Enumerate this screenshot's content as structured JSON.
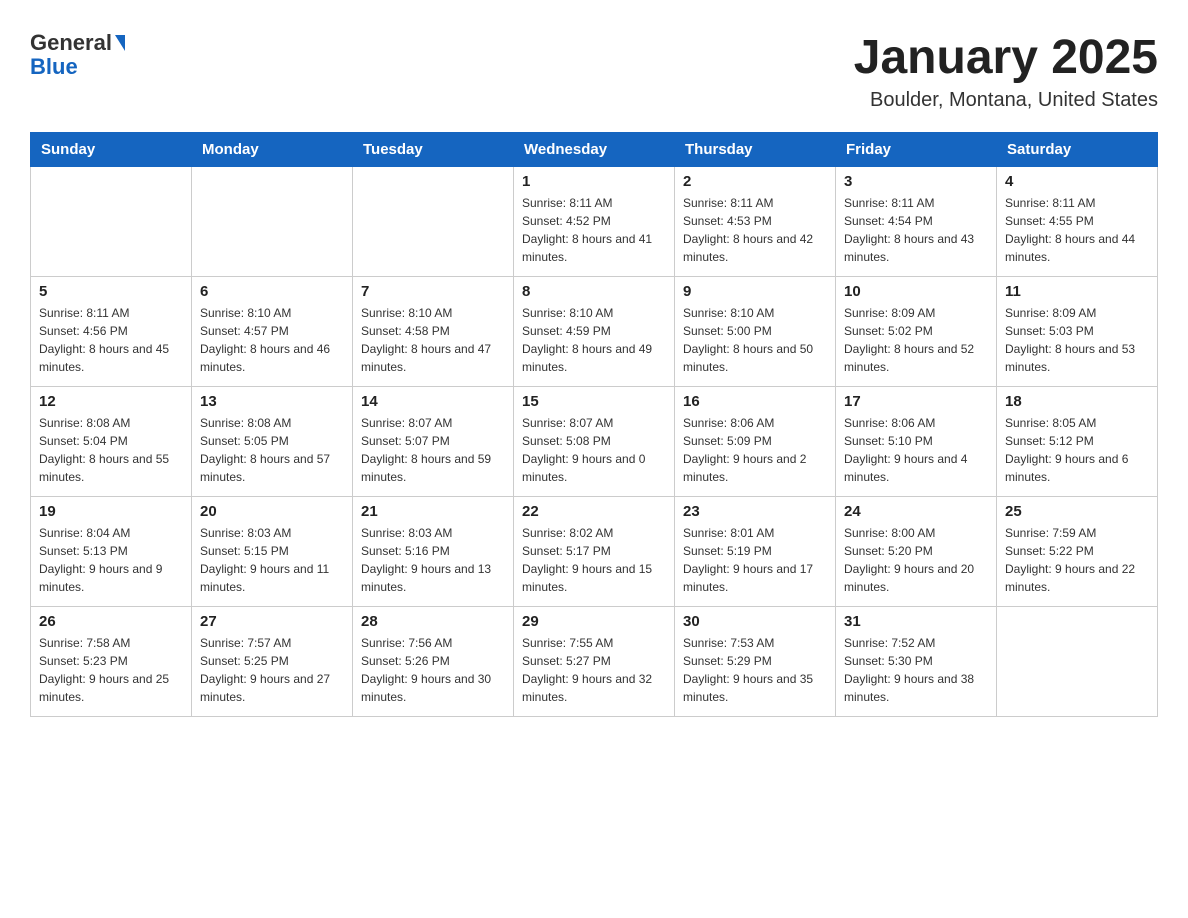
{
  "header": {
    "logo_line1": "General",
    "logo_line2": "Blue",
    "month_title": "January 2025",
    "location": "Boulder, Montana, United States"
  },
  "days_of_week": [
    "Sunday",
    "Monday",
    "Tuesday",
    "Wednesday",
    "Thursday",
    "Friday",
    "Saturday"
  ],
  "weeks": [
    [
      {
        "day": "",
        "sunrise": "",
        "sunset": "",
        "daylight": ""
      },
      {
        "day": "",
        "sunrise": "",
        "sunset": "",
        "daylight": ""
      },
      {
        "day": "",
        "sunrise": "",
        "sunset": "",
        "daylight": ""
      },
      {
        "day": "1",
        "sunrise": "Sunrise: 8:11 AM",
        "sunset": "Sunset: 4:52 PM",
        "daylight": "Daylight: 8 hours and 41 minutes."
      },
      {
        "day": "2",
        "sunrise": "Sunrise: 8:11 AM",
        "sunset": "Sunset: 4:53 PM",
        "daylight": "Daylight: 8 hours and 42 minutes."
      },
      {
        "day": "3",
        "sunrise": "Sunrise: 8:11 AM",
        "sunset": "Sunset: 4:54 PM",
        "daylight": "Daylight: 8 hours and 43 minutes."
      },
      {
        "day": "4",
        "sunrise": "Sunrise: 8:11 AM",
        "sunset": "Sunset: 4:55 PM",
        "daylight": "Daylight: 8 hours and 44 minutes."
      }
    ],
    [
      {
        "day": "5",
        "sunrise": "Sunrise: 8:11 AM",
        "sunset": "Sunset: 4:56 PM",
        "daylight": "Daylight: 8 hours and 45 minutes."
      },
      {
        "day": "6",
        "sunrise": "Sunrise: 8:10 AM",
        "sunset": "Sunset: 4:57 PM",
        "daylight": "Daylight: 8 hours and 46 minutes."
      },
      {
        "day": "7",
        "sunrise": "Sunrise: 8:10 AM",
        "sunset": "Sunset: 4:58 PM",
        "daylight": "Daylight: 8 hours and 47 minutes."
      },
      {
        "day": "8",
        "sunrise": "Sunrise: 8:10 AM",
        "sunset": "Sunset: 4:59 PM",
        "daylight": "Daylight: 8 hours and 49 minutes."
      },
      {
        "day": "9",
        "sunrise": "Sunrise: 8:10 AM",
        "sunset": "Sunset: 5:00 PM",
        "daylight": "Daylight: 8 hours and 50 minutes."
      },
      {
        "day": "10",
        "sunrise": "Sunrise: 8:09 AM",
        "sunset": "Sunset: 5:02 PM",
        "daylight": "Daylight: 8 hours and 52 minutes."
      },
      {
        "day": "11",
        "sunrise": "Sunrise: 8:09 AM",
        "sunset": "Sunset: 5:03 PM",
        "daylight": "Daylight: 8 hours and 53 minutes."
      }
    ],
    [
      {
        "day": "12",
        "sunrise": "Sunrise: 8:08 AM",
        "sunset": "Sunset: 5:04 PM",
        "daylight": "Daylight: 8 hours and 55 minutes."
      },
      {
        "day": "13",
        "sunrise": "Sunrise: 8:08 AM",
        "sunset": "Sunset: 5:05 PM",
        "daylight": "Daylight: 8 hours and 57 minutes."
      },
      {
        "day": "14",
        "sunrise": "Sunrise: 8:07 AM",
        "sunset": "Sunset: 5:07 PM",
        "daylight": "Daylight: 8 hours and 59 minutes."
      },
      {
        "day": "15",
        "sunrise": "Sunrise: 8:07 AM",
        "sunset": "Sunset: 5:08 PM",
        "daylight": "Daylight: 9 hours and 0 minutes."
      },
      {
        "day": "16",
        "sunrise": "Sunrise: 8:06 AM",
        "sunset": "Sunset: 5:09 PM",
        "daylight": "Daylight: 9 hours and 2 minutes."
      },
      {
        "day": "17",
        "sunrise": "Sunrise: 8:06 AM",
        "sunset": "Sunset: 5:10 PM",
        "daylight": "Daylight: 9 hours and 4 minutes."
      },
      {
        "day": "18",
        "sunrise": "Sunrise: 8:05 AM",
        "sunset": "Sunset: 5:12 PM",
        "daylight": "Daylight: 9 hours and 6 minutes."
      }
    ],
    [
      {
        "day": "19",
        "sunrise": "Sunrise: 8:04 AM",
        "sunset": "Sunset: 5:13 PM",
        "daylight": "Daylight: 9 hours and 9 minutes."
      },
      {
        "day": "20",
        "sunrise": "Sunrise: 8:03 AM",
        "sunset": "Sunset: 5:15 PM",
        "daylight": "Daylight: 9 hours and 11 minutes."
      },
      {
        "day": "21",
        "sunrise": "Sunrise: 8:03 AM",
        "sunset": "Sunset: 5:16 PM",
        "daylight": "Daylight: 9 hours and 13 minutes."
      },
      {
        "day": "22",
        "sunrise": "Sunrise: 8:02 AM",
        "sunset": "Sunset: 5:17 PM",
        "daylight": "Daylight: 9 hours and 15 minutes."
      },
      {
        "day": "23",
        "sunrise": "Sunrise: 8:01 AM",
        "sunset": "Sunset: 5:19 PM",
        "daylight": "Daylight: 9 hours and 17 minutes."
      },
      {
        "day": "24",
        "sunrise": "Sunrise: 8:00 AM",
        "sunset": "Sunset: 5:20 PM",
        "daylight": "Daylight: 9 hours and 20 minutes."
      },
      {
        "day": "25",
        "sunrise": "Sunrise: 7:59 AM",
        "sunset": "Sunset: 5:22 PM",
        "daylight": "Daylight: 9 hours and 22 minutes."
      }
    ],
    [
      {
        "day": "26",
        "sunrise": "Sunrise: 7:58 AM",
        "sunset": "Sunset: 5:23 PM",
        "daylight": "Daylight: 9 hours and 25 minutes."
      },
      {
        "day": "27",
        "sunrise": "Sunrise: 7:57 AM",
        "sunset": "Sunset: 5:25 PM",
        "daylight": "Daylight: 9 hours and 27 minutes."
      },
      {
        "day": "28",
        "sunrise": "Sunrise: 7:56 AM",
        "sunset": "Sunset: 5:26 PM",
        "daylight": "Daylight: 9 hours and 30 minutes."
      },
      {
        "day": "29",
        "sunrise": "Sunrise: 7:55 AM",
        "sunset": "Sunset: 5:27 PM",
        "daylight": "Daylight: 9 hours and 32 minutes."
      },
      {
        "day": "30",
        "sunrise": "Sunrise: 7:53 AM",
        "sunset": "Sunset: 5:29 PM",
        "daylight": "Daylight: 9 hours and 35 minutes."
      },
      {
        "day": "31",
        "sunrise": "Sunrise: 7:52 AM",
        "sunset": "Sunset: 5:30 PM",
        "daylight": "Daylight: 9 hours and 38 minutes."
      },
      {
        "day": "",
        "sunrise": "",
        "sunset": "",
        "daylight": ""
      }
    ]
  ]
}
